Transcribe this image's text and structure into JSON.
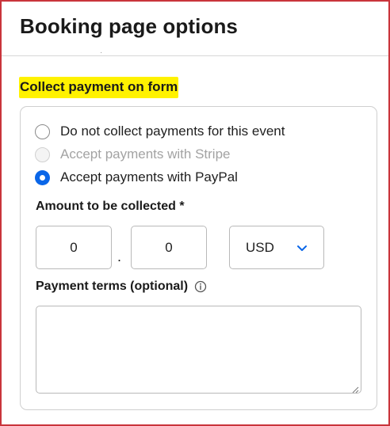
{
  "header": {
    "title": "Booking page options"
  },
  "section": {
    "title": "Collect payment on form"
  },
  "payment_options": [
    {
      "label": "Do not collect payments for this event",
      "state": "unchecked"
    },
    {
      "label": "Accept payments with Stripe",
      "state": "disabled"
    },
    {
      "label": "Accept payments with PayPal",
      "state": "checked"
    }
  ],
  "amount": {
    "label": "Amount to be collected *",
    "whole_value": "0",
    "separator": ".",
    "fraction_value": "0",
    "currency": "USD",
    "currency_icon": "chevron-down-icon"
  },
  "terms": {
    "label": "Payment terms (optional)",
    "info_icon": "info-icon",
    "value": ""
  },
  "colors": {
    "accent": "#0a66e8",
    "highlight": "#fff200",
    "frame": "#c9343b"
  }
}
